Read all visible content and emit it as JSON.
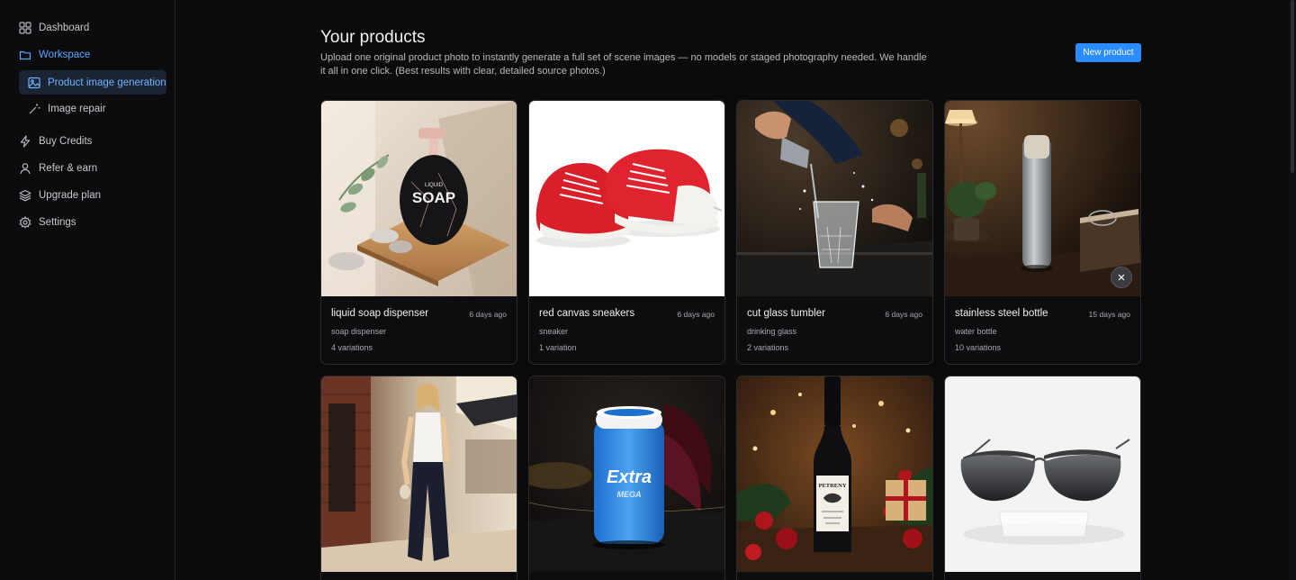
{
  "sidebar": {
    "items": [
      {
        "label": "Dashboard",
        "icon": "grid-icon"
      },
      {
        "label": "Workspace",
        "icon": "folder-icon"
      },
      {
        "label": "Product image generation",
        "icon": "image-icon"
      },
      {
        "label": "Image repair",
        "icon": "magic-wand-icon"
      },
      {
        "label": "Buy Credits",
        "icon": "lightning-icon"
      },
      {
        "label": "Refer & earn",
        "icon": "user-icon"
      },
      {
        "label": "Upgrade plan",
        "icon": "layers-icon"
      },
      {
        "label": "Settings",
        "icon": "gear-icon"
      }
    ]
  },
  "header": {
    "title": "Your products",
    "subtitle": "Upload one original product photo to instantly generate a full set of scene images — no models or staged photography needed. We handle it all in one click. (Best results with clear, detailed source photos.)",
    "new_button": "New product"
  },
  "products": [
    {
      "name": "liquid soap dispenser",
      "date": "6 days ago",
      "category": "soap dispenser",
      "variations": "4 variations"
    },
    {
      "name": "red canvas sneakers",
      "date": "6 days ago",
      "category": "sneaker",
      "variations": "1 variation"
    },
    {
      "name": "cut glass tumbler",
      "date": "6 days ago",
      "category": "drinking glass",
      "variations": "2 variations"
    },
    {
      "name": "stainless steel bottle",
      "date": "15 days ago",
      "category": "water bottle",
      "variations": "10 variations"
    },
    {
      "name": "",
      "date": "",
      "category": "",
      "variations": ""
    },
    {
      "name": "",
      "date": "",
      "category": "",
      "variations": ""
    },
    {
      "name": "",
      "date": "",
      "category": "",
      "variations": ""
    },
    {
      "name": "",
      "date": "",
      "category": "",
      "variations": ""
    }
  ],
  "image_text": {
    "soap_big": "SOAP",
    "soap_small": "LIQUID",
    "gum_brand": "Extra",
    "gum_sub": "MEGA",
    "wine_label": "PETRENY"
  },
  "colors": {
    "accent": "#2a8cff",
    "active_nav_bg": "#1a2433",
    "active_nav_text": "#6fb3ff"
  }
}
